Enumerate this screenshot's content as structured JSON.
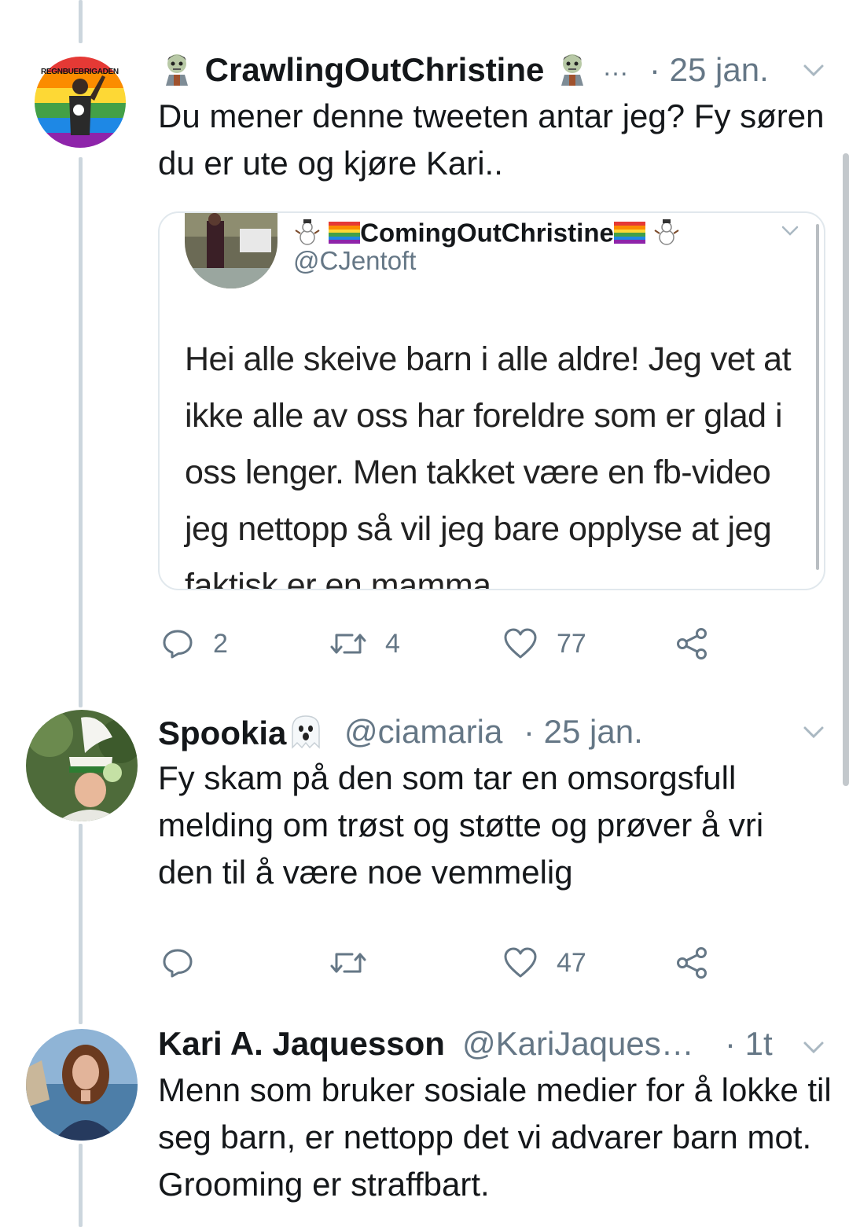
{
  "tweets": [
    {
      "name": "CrawlingOutChristine",
      "ellipsis": "…",
      "time": "· 25 jan.",
      "text": "Du mener denne tweeten antar jeg? Fy søren du er ute og kjøre Kari..",
      "avatar_caption": "REGNBUEBRIGADEN",
      "quote": {
        "name": "ComingOutChristine",
        "handle": "@CJentoft",
        "text": "Hei alle skeive barn i alle aldre! Jeg vet at ikke alle av oss har foreldre som er glad i oss lenger. Men takket være en fb-video jeg nettopp så vil jeg bare opplyse at jeg faktisk er en mamma."
      },
      "actions": {
        "replies": "2",
        "retweets": "4",
        "likes": "77"
      }
    },
    {
      "name": "Spookia",
      "handle": "@ciamaria",
      "time": "· 25 jan.",
      "text": "Fy skam på den som tar en omsorgsfull melding om trøst og støtte og prøver å vri den til å være noe vemmelig",
      "actions": {
        "replies": "",
        "retweets": "",
        "likes": "47"
      }
    },
    {
      "name": "Kari A. Jaquesson",
      "handle": "@KariJaques…",
      "time": "· 1t",
      "text": "Menn som bruker sosiale medier for å lokke til seg barn, er nettopp det vi advarer barn mot. Grooming er straffbart."
    }
  ],
  "colors": {
    "text": "#14171a",
    "secondary": "#657786",
    "border": "#e1e8ed",
    "thread": "#ccd6dd"
  },
  "icons": [
    "reply-icon",
    "retweet-icon",
    "like-icon",
    "share-icon",
    "chevron-down-icon",
    "zombie-emoji",
    "rainbow-flag-emoji",
    "snowman-emoji",
    "ghost-emoji"
  ]
}
